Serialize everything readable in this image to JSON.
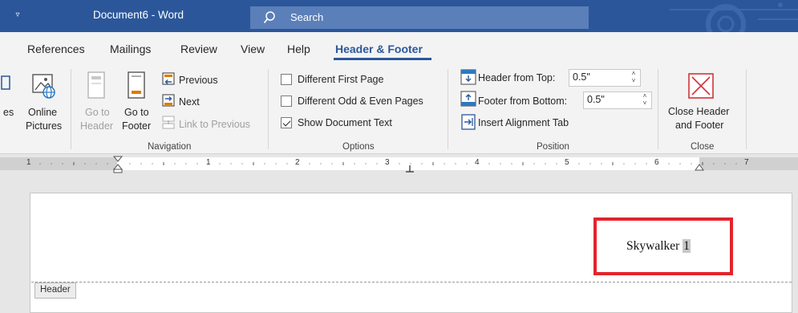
{
  "titlebar": {
    "qat_glyph": "▿",
    "doc_title": "Document6  -  Word",
    "search_placeholder": "Search"
  },
  "tabs": [
    {
      "label": "References"
    },
    {
      "label": "Mailings"
    },
    {
      "label": "Review"
    },
    {
      "label": "View"
    },
    {
      "label": "Help"
    },
    {
      "label": "Header & Footer",
      "active": true
    }
  ],
  "ribbon": {
    "insert": {
      "partial_label": "es",
      "online_pictures_line1": "Online",
      "online_pictures_line2": "Pictures"
    },
    "navigation": {
      "goto_header_line1": "Go to",
      "goto_header_line2": "Header",
      "goto_footer_line1": "Go to",
      "goto_footer_line2": "Footer",
      "previous": "Previous",
      "next": "Next",
      "link_to_previous": "Link to Previous",
      "group_label": "Navigation"
    },
    "options": {
      "different_first_page": "Different First Page",
      "different_odd_even": "Different Odd & Even Pages",
      "show_document_text": "Show Document Text",
      "show_document_text_checked": true,
      "group_label": "Options"
    },
    "position": {
      "header_from_top_label": "Header from Top:",
      "header_from_top_value": "0.5\"",
      "footer_from_bottom_label": "Footer from Bottom:",
      "footer_from_bottom_value": "0.5\"",
      "insert_alignment_tab": "Insert Alignment Tab",
      "group_label": "Position"
    },
    "close": {
      "close_line1": "Close Header",
      "close_line2": "and Footer",
      "group_label": "Close"
    }
  },
  "ruler": {
    "numbers": [
      "1",
      "1",
      "2",
      "3",
      "4",
      "5",
      "6",
      "7"
    ]
  },
  "document": {
    "header_text": "Skywalker ",
    "page_number": "1",
    "header_tag": "Header"
  },
  "colors": {
    "accent": "#2b579a",
    "highlight_box": "#e3242b",
    "close_icon": "#d13438"
  }
}
